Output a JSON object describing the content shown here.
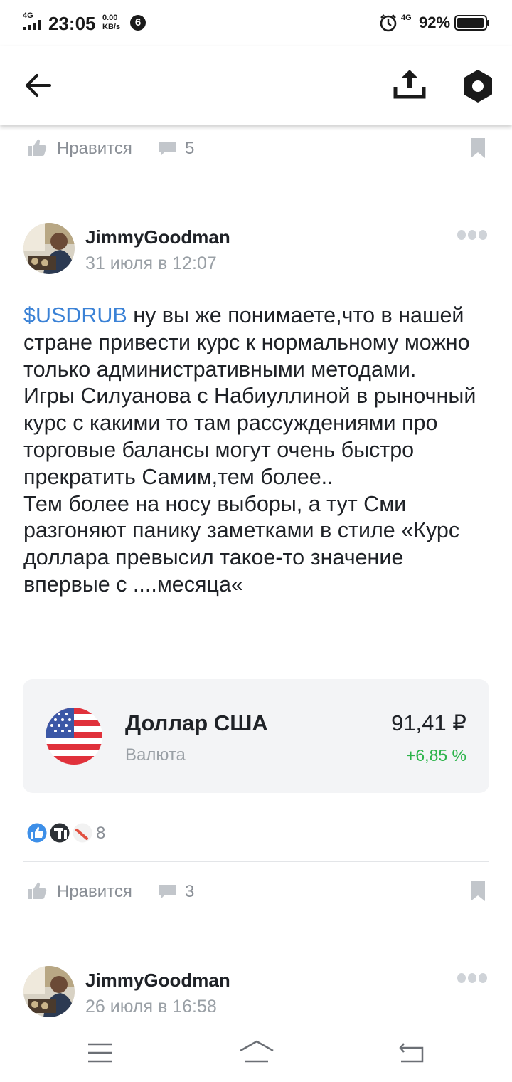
{
  "status_bar": {
    "network_left": "4G",
    "time": "23:05",
    "speed_value": "0.00",
    "speed_unit": "KB/s",
    "notif_count": "6",
    "network_right": "4G",
    "battery": "92%"
  },
  "header": {
    "back_icon": "arrow-left-icon",
    "share_icon": "share-upload-icon",
    "settings_icon": "hexagon-gear-icon"
  },
  "prev_post_actions": {
    "like_label": "Нравится",
    "comments_count": "5"
  },
  "post": {
    "author": "JimmyGoodman",
    "date": "31 июля в 12:07",
    "ticker": "$USDRUB",
    "text_after_ticker": " ну вы же понимаете,что в нашей стране привести курс к нормальному можно только административными методами.",
    "paragraph2": "Игры Силуанова с Набиуллиной в рыночный курс с какими то там рассуждениями про торговые балансы могут очень быстро прекратить Самим,тем более..",
    "paragraph3": "Тем более на носу выборы, а тут Сми разгоняют панику заметками в стиле «Курс доллара превысил такое-то значение впервые с ....месяца«",
    "instrument": {
      "name": "Доллар США",
      "type": "Валюта",
      "price": "91,41 ₽",
      "change": "+6,85 %"
    },
    "reactions_count": "8",
    "like_label": "Нравится",
    "comments_count": "3"
  },
  "next_post": {
    "author": "JimmyGoodman",
    "date": "26 июля в 16:58"
  },
  "colors": {
    "ticker": "#3b82d6",
    "positive": "#2bb34a",
    "card_bg": "#f3f4f6",
    "muted": "#9aa0a6"
  }
}
